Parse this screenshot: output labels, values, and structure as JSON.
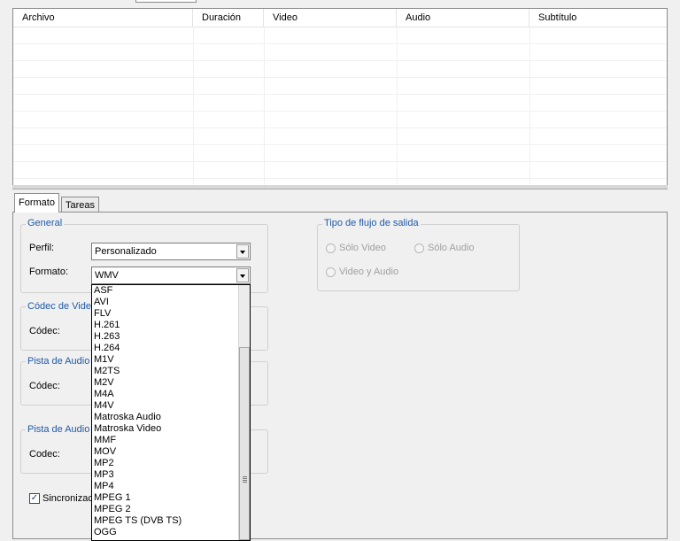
{
  "table": {
    "columns": [
      "Archivo",
      "Duración",
      "Video",
      "Audio",
      "Subtítulo"
    ]
  },
  "tabs": [
    {
      "label": "Formato",
      "active": true
    },
    {
      "label": "Tareas",
      "active": false
    }
  ],
  "general": {
    "title": "General",
    "profile_label": "Perfil:",
    "profile_value": "Personalizado",
    "format_label": "Formato:",
    "format_value": "WMV"
  },
  "video_codec": {
    "title": "Códec de Video",
    "codec_label": "Códec:"
  },
  "audio_track_1": {
    "title": "Pista de Audio",
    "codec_label": "Códec:"
  },
  "audio_track_2": {
    "title": "Pista de Audio",
    "codec_label": "Codec:"
  },
  "sync_checkbox": {
    "label": "Sincronización",
    "checked": true
  },
  "output_stream": {
    "title": "Tipo de flujo de salida",
    "options": [
      "Sólo Video",
      "Sólo Audio",
      "Video y Audio"
    ]
  },
  "format_options": [
    "ASF",
    "AVI",
    "FLV",
    "H.261",
    "H.263",
    "H.264",
    "M1V",
    "M2TS",
    "M2V",
    "M4A",
    "M4V",
    "Matroska Audio",
    "Matroska Video",
    "MMF",
    "MOV",
    "MP2",
    "MP3",
    "MP4",
    "MPEG 1",
    "MPEG 2",
    "MPEG TS (DVB TS)",
    "OGG"
  ]
}
